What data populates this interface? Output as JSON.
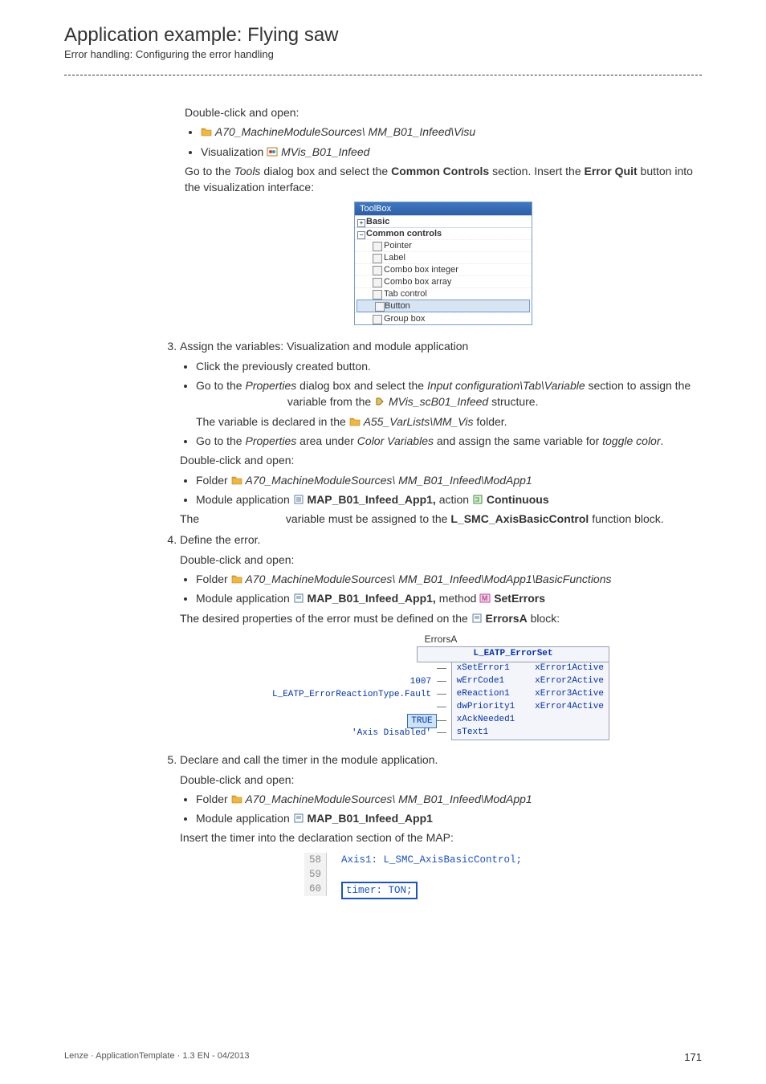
{
  "header": {
    "title": "Application example: Flying saw",
    "subtitle": "Error handling: Configuring the error handling"
  },
  "body": {
    "dc_open1": "Double-click and open:",
    "open1_item1": "A70_MachineModuleSources\\ MM_B01_Infeed\\Visu",
    "open1_item2_pre": "Visualization ",
    "open1_item2_name": "MVis_B01_Infeed",
    "tools_para_pre": "Go to the ",
    "tools_para_tools": "Tools",
    "tools_para_mid": " dialog box and select the ",
    "tools_para_cc": "Common Controls",
    "tools_para_mid2": " section. Insert the ",
    "tools_para_eq": "Error Quit",
    "tools_para_end": " button into the visualization interface:",
    "toolbox": {
      "header": "ToolBox",
      "basic": "Basic",
      "common": "Common controls",
      "items": [
        "Pointer",
        "Label",
        "Combo box integer",
        "Combo box array",
        "Tab control",
        "Button",
        "Group box"
      ]
    },
    "step3": {
      "heading": "Assign the variables: Visualization and module application",
      "b1": "Click the previously created button.",
      "b2_pre": "Go to the ",
      "b2_props": "Properties",
      "b2_mid1": " dialog box and select the ",
      "b2_section": "Input configuration\\Tab\\Variable",
      "b2_mid2": " section to assign the ",
      "b2_mid3": " variable from the ",
      "b2_struct": "MVis_scB01_Infeed",
      "b2_end": " structure.",
      "b2_note_pre": "The variable is declared in the ",
      "b2_note_folder": "A55_VarLists\\MM_Vis",
      "b2_note_end": " folder.",
      "b3_pre": "Go to the ",
      "b3_props": "Properties",
      "b3_mid1": " area under ",
      "b3_cv": "Color Variables",
      "b3_mid2": " and assign the same variable for ",
      "b3_toggle": "toggle color",
      "b3_end": ".",
      "dco2": "Double-click and open:",
      "f1_pre": "Folder ",
      "f1": "A70_MachineModuleSources\\ MM_B01_Infeed\\ModApp1",
      "m1_pre": "Module application ",
      "m1": "MAP_B01_Infeed_App1,",
      "m1_action_pre": " action ",
      "m1_action": "Continuous",
      "assign_pre": "The ",
      "assign_mid": " variable must be assigned to the ",
      "assign_fb": "L_SMC_AxisBasicControl",
      "assign_end": " function block."
    },
    "step4": {
      "heading": "Define the error.",
      "dco": "Double-click and open:",
      "f1_pre": "Folder ",
      "f1": "A70_MachineModuleSources\\ MM_B01_Infeed\\ModApp1\\BasicFunctions",
      "m1_pre": "Module application ",
      "m1": "MAP_B01_Infeed_App1,",
      "m1_method_pre": " method ",
      "m1_method": "SetErrors",
      "props_pre": "The desired properties of the error must be defined on the ",
      "props_block": "ErrorsA",
      "props_end": " block:"
    },
    "step5": {
      "heading": "Declare and call the timer in the module application.",
      "dco": "Double-click and open:",
      "f1_pre": "Folder ",
      "f1": "A70_MachineModuleSources\\ MM_B01_Infeed\\ModApp1",
      "m1_pre": "Module application ",
      "m1": "MAP_B01_Infeed_App1",
      "insert": "Insert the timer into the declaration section of the MAP:"
    }
  },
  "chart_data": {
    "type": "table",
    "title": "ErrorsA",
    "subtitle": "L_EATP_ErrorSet",
    "inputs": [
      {
        "port": "xSetError1",
        "value": ""
      },
      {
        "port": "wErrCode1",
        "value": "1007"
      },
      {
        "port": "eReaction1",
        "value": "L_EATP_ErrorReactionType.Fault"
      },
      {
        "port": "dwPriority1",
        "value": ""
      },
      {
        "port": "xAckNeeded1",
        "value": "TRUE"
      },
      {
        "port": "sText1",
        "value": "'Axis Disabled'"
      }
    ],
    "outputs": [
      "xError1Active",
      "xError2Active",
      "xError3Active",
      "xError4Active"
    ]
  },
  "code": {
    "lines": [
      {
        "num": "58",
        "text": "Axis1: L_SMC_AxisBasicControl;"
      },
      {
        "num": "59",
        "text": ""
      },
      {
        "num": "60",
        "text": "timer: TON;",
        "boxed": true
      }
    ]
  },
  "footer": {
    "left": "Lenze · ApplicationTemplate · 1.3 EN - 04/2013",
    "page": "171"
  }
}
